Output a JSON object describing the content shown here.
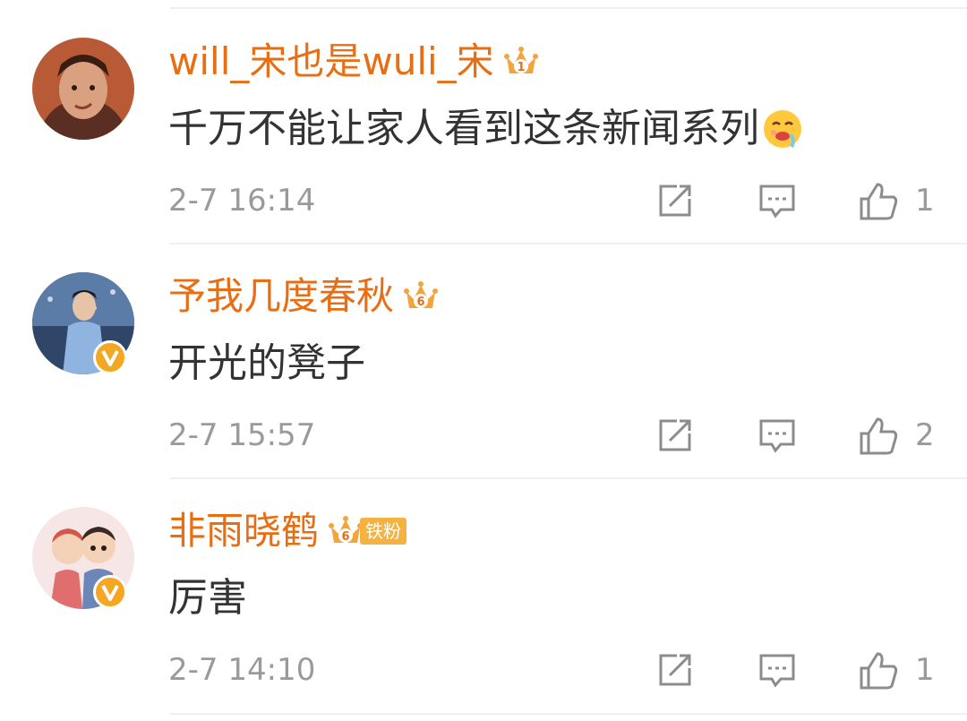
{
  "comments": [
    {
      "username": "will_宋也是wuli_宋",
      "crown_level": "1",
      "text": "千万不能让家人看到这条新闻系列",
      "emoji": "drooling-face-emoji",
      "time": "2-7 16:14",
      "likes": "1",
      "avatar_bg": "#b85a36",
      "verified": false
    },
    {
      "username": "予我几度春秋",
      "crown_level": "6",
      "text": "开光的凳子",
      "time": "2-7 15:57",
      "likes": "2",
      "avatar_bg": "#4d6e96",
      "verified": true
    },
    {
      "username": "非雨晓鹤",
      "crown_level": "6",
      "fan_tag": "铁粉",
      "text": "厉害",
      "time": "2-7 14:10",
      "likes": "1",
      "avatar_bg": "#f6e6e6",
      "verified": true
    }
  ],
  "colors": {
    "username": "#e86e14",
    "crown": "#f3a43a",
    "verified_badge": "#f5a623",
    "meta_text": "#9a9a9a",
    "comment_text": "#333333"
  },
  "icons": {
    "share": "share-icon",
    "comment": "comment-icon",
    "like": "thumbs-up-icon",
    "crown": "crown-icon",
    "verified": "verified-v-icon"
  }
}
